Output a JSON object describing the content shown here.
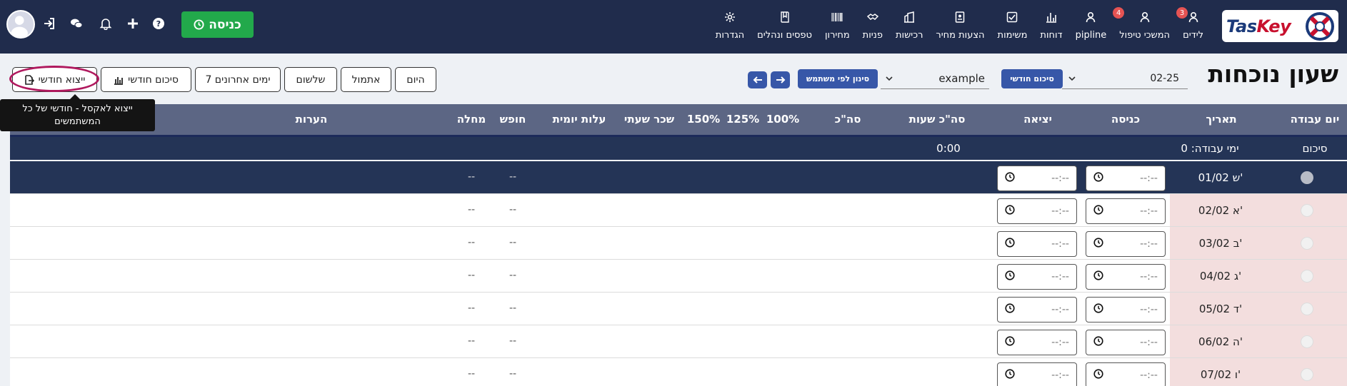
{
  "logo": {
    "text_part1": "Tas",
    "text_part2": "Key"
  },
  "nav": [
    {
      "label": "לידים",
      "icon": "user-tie-icon",
      "badge": "3"
    },
    {
      "label": "המשכי טיפול",
      "icon": "user-tie-icon",
      "badge": "4"
    },
    {
      "label": "pipline",
      "icon": "user-tie-icon",
      "badge": ""
    },
    {
      "label": "דוחות",
      "icon": "bar-chart-icon",
      "badge": ""
    },
    {
      "label": "משימות",
      "icon": "checkbox-icon",
      "badge": ""
    },
    {
      "label": "הצעות מחיר",
      "icon": "document-icon",
      "badge": ""
    },
    {
      "label": "רכישות",
      "icon": "building-icon",
      "badge": ""
    },
    {
      "label": "פניות",
      "icon": "handshake-icon",
      "badge": ""
    },
    {
      "label": "מחירון",
      "icon": "barcode-icon",
      "badge": ""
    },
    {
      "label": "טפסים ונהלים",
      "icon": "book-icon",
      "badge": ""
    },
    {
      "label": "הגדרות",
      "icon": "gear-icon",
      "badge": ""
    }
  ],
  "checkin_label": "כניסה",
  "page_title": "שעון נוכחות",
  "date_value": "02-25",
  "monthly_summary_label": "סיכום חודשי",
  "user_value": "example",
  "filter_by_user_label": "סינון לפי משתמש",
  "range_buttons": {
    "today": "היום",
    "yesterday": "אתמול",
    "three_days": "שלשום",
    "last7": "7 ימים אחרונים",
    "monthly_summary": "סיכום חודשי",
    "monthly_export": "ייצוא חודשי"
  },
  "tooltip": "ייצוא לאקסל - חודשי של כל המשתמשים",
  "table": {
    "headers": {
      "workday": "יום עבודה",
      "date": "תאריך",
      "entry": "כניסה",
      "exit": "יציאה",
      "total_hours": "סה\"כ שעות",
      "total": "סה\"כ",
      "p100": "100%",
      "p125": "125%",
      "p150": "150%",
      "hourly_wage": "שכר שעתי",
      "daily_cost": "עלות יומית",
      "vacation": "חופש",
      "sick": "מחלה",
      "notes": "הערות"
    },
    "summary": {
      "label": "סיכום",
      "workdays": "ימי עבודה: 0",
      "total_hours": "0:00"
    },
    "time_placeholder": "--:--",
    "empty_value": "--",
    "rows": [
      {
        "date": "01/02 ש'",
        "active": true
      },
      {
        "date": "02/02 א'",
        "active": false
      },
      {
        "date": "03/02 ב'",
        "active": false
      },
      {
        "date": "04/02 ג'",
        "active": false
      },
      {
        "date": "05/02 ד'",
        "active": false
      },
      {
        "date": "06/02 ה'",
        "active": false
      },
      {
        "date": "07/02 ו'",
        "active": false
      }
    ]
  }
}
